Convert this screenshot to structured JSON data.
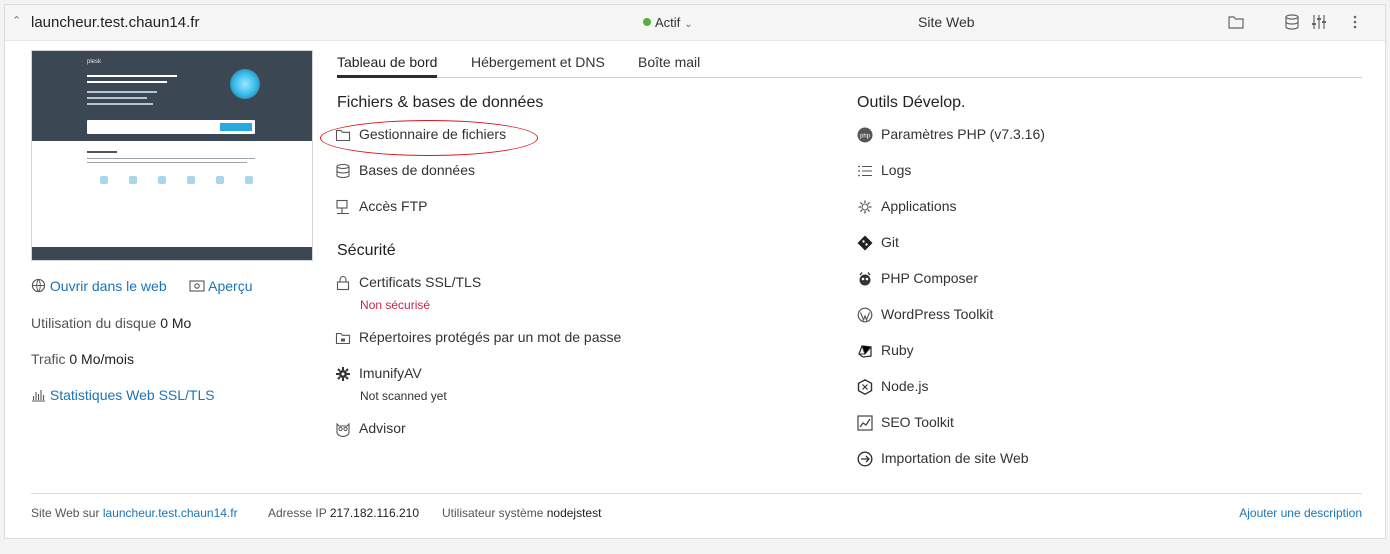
{
  "header": {
    "domain": "launcheur.test.chaun14.fr",
    "status": "Actif",
    "site_type": "Site Web"
  },
  "preview": {
    "brand": "plesk"
  },
  "left": {
    "open_web": "Ouvrir dans le web",
    "apercu": "Aperçu",
    "disk_label": "Utilisation du disque",
    "disk_value": "0 Mo",
    "traffic_label": "Trafic",
    "traffic_value": "0 Mo/mois",
    "stats": "Statistiques Web SSL/TLS"
  },
  "tabs": [
    "Tableau de bord",
    "Hébergement et DNS",
    "Boîte mail"
  ],
  "files_section": {
    "title": "Fichiers & bases de données",
    "items": [
      "Gestionnaire de fichiers",
      "Bases de données",
      "Accès FTP"
    ]
  },
  "security_section": {
    "title": "Sécurité",
    "ssl": "Certificats SSL/TLS",
    "ssl_status": "Non sécurisé",
    "protected_dirs": "Répertoires protégés par un mot de passe",
    "imunify": "ImunifyAV",
    "imunify_status": "Not scanned yet",
    "advisor": "Advisor"
  },
  "dev_section": {
    "title": "Outils Dévelop.",
    "items": [
      "Paramètres PHP (v7.3.16)",
      "Logs",
      "Applications",
      "Git",
      "PHP Composer",
      "WordPress Toolkit",
      "Ruby",
      "Node.js",
      "SEO Toolkit",
      "Importation de site Web"
    ]
  },
  "footer": {
    "site_label": "Site Web sur",
    "site_link": "launcheur.test.chaun14.fr",
    "ip_label": "Adresse IP",
    "ip_value": "217.182.116.210",
    "user_label": "Utilisateur système",
    "user_value": "nodejstest",
    "add_desc": "Ajouter une description"
  },
  "colors": {
    "link": "#1a74b8",
    "status_green": "#56b135",
    "warning_red": "#c7254e",
    "annotation_red": "#d8191f"
  },
  "icons": {
    "collapse": "chevron-up-icon",
    "status_caret": "chevron-down-icon",
    "folder": "folder-icon",
    "database": "database-icon",
    "settings": "sliders-icon",
    "more": "kebab-icon"
  }
}
